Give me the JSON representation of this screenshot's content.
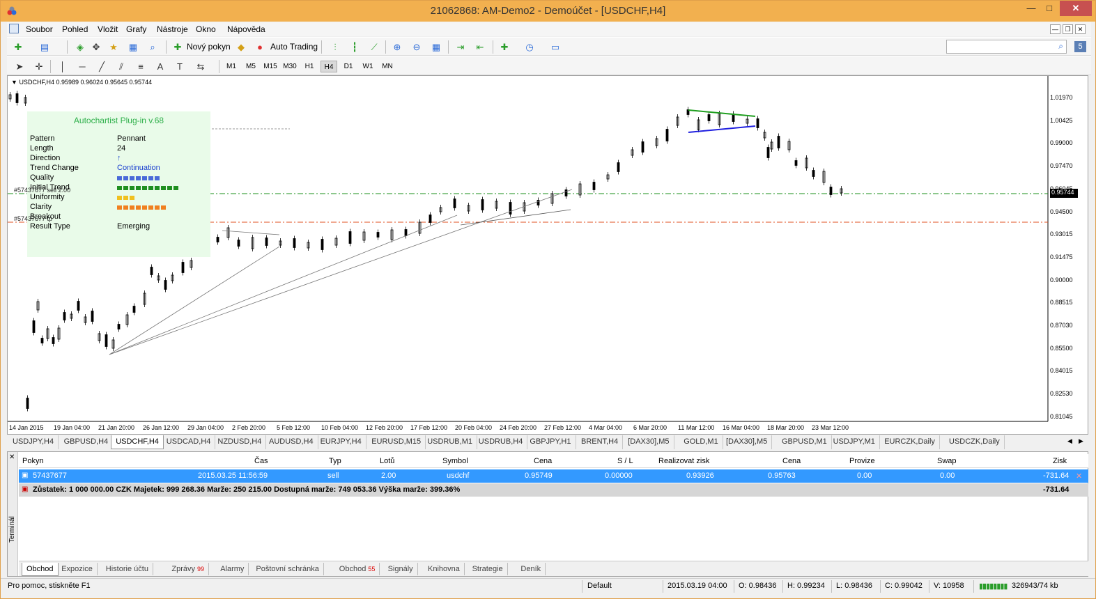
{
  "window": {
    "title": "21062868: AM-Demo2 - Demoúčet - [USDCHF,H4]",
    "min": "—",
    "max": "□",
    "close": "✕"
  },
  "menu": [
    "Soubor",
    "Pohled",
    "Vložit",
    "Grafy",
    "Nástroje",
    "Okno",
    "Nápověda"
  ],
  "mdi": {
    "min": "—",
    "restore": "❐",
    "close": "✕"
  },
  "toolbar": {
    "new_order": "Nový pokyn",
    "auto_trading": "Auto Trading",
    "badge": "5"
  },
  "timeframes": [
    "M1",
    "M5",
    "M15",
    "M30",
    "H1",
    "H4",
    "D1",
    "W1",
    "MN"
  ],
  "timeframe_selected": "H4",
  "chart": {
    "info": "USDCHF,H4  0.95989 0.96024 0.95645 0.95744",
    "current_price": "0.95744",
    "order_label_1": "#57437677 sell 2.00",
    "order_label_2": "#57437677 tp",
    "price_labels": [
      "1.01970",
      "1.00425",
      "0.99000",
      "0.97470",
      "0.96045",
      "0.94500",
      "0.93015",
      "0.91475",
      "0.90000",
      "0.88515",
      "0.87030",
      "0.85500",
      "0.84015",
      "0.82530",
      "0.81045"
    ],
    "time_labels": [
      "14 Jan 2015",
      "19 Jan 04:00",
      "21 Jan 20:00",
      "26 Jan 12:00",
      "29 Jan 04:00",
      "2 Feb 20:00",
      "5 Feb 12:00",
      "10 Feb 04:00",
      "12 Feb 20:00",
      "17 Feb 12:00",
      "20 Feb 04:00",
      "24 Feb 20:00",
      "27 Feb 12:00",
      "4 Mar 04:00",
      "6 Mar 20:00",
      "11 Mar 12:00",
      "16 Mar 04:00",
      "18 Mar 20:00",
      "23 Mar 12:00"
    ],
    "colors": {
      "bid_line": "#1a8f1a",
      "tp_line": "#e05020",
      "pennant_top": "#1f9e1f",
      "pennant_bottom": "#2020e0"
    }
  },
  "autochartist": {
    "title": "Autochartist Plug-in v.68",
    "rows": [
      {
        "label": "Pattern",
        "value": "Pennant"
      },
      {
        "label": "Length",
        "value": "24"
      },
      {
        "label": "Direction",
        "value": "↑"
      },
      {
        "label": "Trend Change",
        "value": "Continuation"
      },
      {
        "label": "Quality",
        "value": ""
      },
      {
        "label": "Initial Trend",
        "value": ""
      },
      {
        "label": "Uniformity",
        "value": ""
      },
      {
        "label": "Clarity",
        "value": ""
      },
      {
        "label": "Breakout",
        "value": ""
      },
      {
        "label": "Result Type",
        "value": "Emerging"
      }
    ],
    "bars": {
      "quality": 7,
      "initial_trend": 10,
      "uniformity": 3,
      "clarity": 8
    }
  },
  "chart_tabs": [
    "USDJPY,H4",
    "GBPUSD,H4",
    "USDCHF,H4",
    "USDCAD,H4",
    "NZDUSD,H4",
    "AUDUSD,H4",
    "EURJPY,H4",
    "EURUSD,M15",
    "USDRUB,M1",
    "USDRUB,H4",
    "GBPJPY,H1",
    "BRENT,H4",
    "[DAX30],M5",
    "GOLD,M1",
    "[DAX30],M5",
    "GBPUSD,M1",
    "USDJPY,M1",
    "EURCZK,Daily",
    "USDCZK,Daily"
  ],
  "chart_tab_active": "USDCHF,H4",
  "terminal": {
    "side_label": "Terminál",
    "headers": [
      "Pokyn",
      "Čas",
      "Typ",
      "Lotů",
      "Symbol",
      "Cena",
      "S / L",
      "Realizovat zisk",
      "Cena",
      "Provize",
      "Swap",
      "Zisk"
    ],
    "order": {
      "id": "57437677",
      "time": "2015.03.25 11:56:59",
      "type": "sell",
      "lots": "2.00",
      "symbol": "usdchf",
      "price": "0.95749",
      "sl": "0.00000",
      "tp": "0.93926",
      "cur_price": "0.95763",
      "commission": "0.00",
      "swap": "0.00",
      "profit": "-731.64"
    },
    "summary": "Zůstatek: 1 000 000.00 CZK  Majetek: 999 268.36  Marže: 250 215.00  Dostupná marže: 749 053.36  Výška marže: 399.36%",
    "summary_profit": "-731.64",
    "tabs": [
      {
        "label": "Obchod",
        "count": ""
      },
      {
        "label": "Expozice",
        "count": ""
      },
      {
        "label": "Historie účtu",
        "count": ""
      },
      {
        "label": "Zprávy",
        "count": "99"
      },
      {
        "label": "Alarmy",
        "count": ""
      },
      {
        "label": "Poštovní schránka",
        "count": ""
      },
      {
        "label": "Obchod",
        "count": "55"
      },
      {
        "label": "Signály",
        "count": ""
      },
      {
        "label": "Knihovna",
        "count": ""
      },
      {
        "label": "Strategie",
        "count": ""
      },
      {
        "label": "Deník",
        "count": ""
      }
    ]
  },
  "status": {
    "help": "Pro pomoc, stiskněte F1",
    "profile": "Default",
    "datetime": "2015.03.19 04:00",
    "open": "O: 0.98436",
    "high": "H: 0.99234",
    "low": "L: 0.98436",
    "close": "C: 0.99042",
    "volume": "V: 10958",
    "traffic": "326943/74 kb"
  }
}
